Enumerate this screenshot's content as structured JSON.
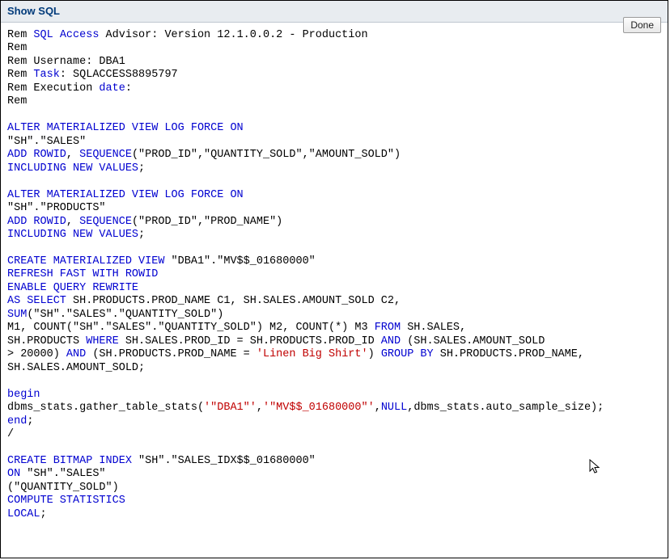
{
  "header": {
    "title": "Show SQL",
    "done_label": "Done"
  },
  "t": {
    "rem": "Rem",
    "sql_access": "SQL Access",
    "advisor_line": " Advisor: Version 12.1.0.0.2 - Production",
    "username_label": "Rem Username: DBA1",
    "task_word": "Task",
    "task_rest": ": SQLACCESS8895797",
    "exec_rem": "Rem Execution ",
    "date_word": "date",
    "colon": ":",
    "alter_mv_log": "ALTER MATERIALIZED VIEW LOG FORCE ON",
    "sh_sales": "\"SH\".\"SALES\"",
    "add_rowid": "ADD ROWID",
    "comma_sp": ", ",
    "sequence": "SEQUENCE",
    "seq1_args": "(\"PROD_ID\",\"QUANTITY_SOLD\",\"AMOUNT_SOLD\")",
    "incl_new_values": "INCLUDING NEW VALUES",
    "semi": ";",
    "sh_products": "\"SH\".\"PRODUCTS\"",
    "seq2_args": "(\"PROD_ID\",\"PROD_NAME\")",
    "create_mv": "CREATE MATERIALIZED VIEW",
    "mv_name": " \"DBA1\".\"MV$$_01680000\"",
    "refresh_fast": "REFRESH FAST WITH ROWID",
    "enable_qr": "ENABLE QUERY REWRITE",
    "as_select": "AS SELECT",
    "sel_cols": " SH.PRODUCTS.PROD_NAME C1, SH.SALES.AMOUNT_SOLD C2,",
    "sum": "SUM",
    "sum_arg": "(\"SH\".\"SALES\".\"QUANTITY_SOLD\")",
    "m1_count_a": "M1, COUNT(\"SH\".\"SALES\".\"QUANTITY_SOLD\") M2, COUNT(*) M3 ",
    "from": "FROM",
    "from_rest": " SH.SALES,",
    "where_pre": "SH.PRODUCTS ",
    "where": "WHERE",
    "where_mid": " SH.SALES.PROD_ID = SH.PRODUCTS.PROD_ID ",
    "and": "AND",
    "and_rest1": " (SH.SALES.AMOUNT_SOLD",
    "gt20000": "> 20000) ",
    "prod_name_eq": " (SH.PRODUCTS.PROD_NAME = ",
    "linen": "'Linen Big Shirt'",
    "paren_sp": ") ",
    "group_by": "GROUP BY",
    "group_rest": " SH.PRODUCTS.PROD_NAME,",
    "amount_sold_line": "SH.SALES.AMOUNT_SOLD;",
    "begin": "begin",
    "gather_a": "dbms_stats.gather_table_stats(",
    "gather_s1": "'\"DBA1\"'",
    "comma": ",",
    "gather_s2": "'\"MV$$_01680000\"'",
    "null": "NULL",
    "gather_tail": ",dbms_stats.auto_sample_size);",
    "end": "end",
    "slash": "/",
    "create_bitmap": "CREATE BITMAP INDEX",
    "bitmap_name": " \"SH\".\"SALES_IDX$$_01680000\"",
    "on": "ON",
    "on_rest": " \"SH\".\"SALES\"",
    "qty_sold": "(\"QUANTITY_SOLD\")",
    "compute_stats": "COMPUTE STATISTICS",
    "local": "LOCAL"
  }
}
